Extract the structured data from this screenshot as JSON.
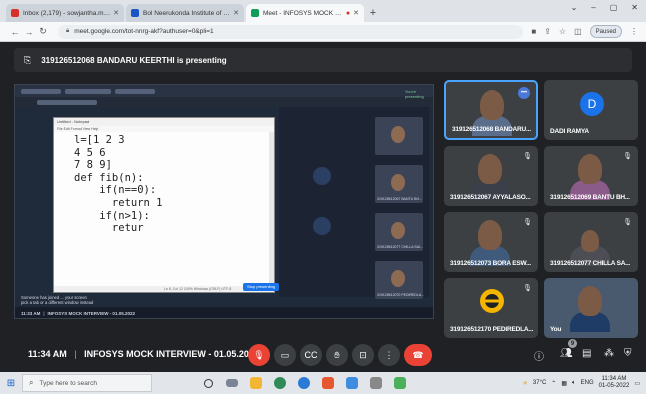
{
  "browser": {
    "tabs": [
      {
        "label": "Inbox (2,179) - sowjantha.mcr@",
        "icon_color": "#d93025",
        "active": false
      },
      {
        "label": "Bol Neerukonda Institute of Tec",
        "icon_color": "#1a56c7",
        "active": false
      },
      {
        "label": "Meet - INFOSYS MOCK INTE",
        "icon_color": "#0f9d58",
        "active": true
      }
    ],
    "new_tab_icon": "plus-icon",
    "url": "meet.google.com/tot-nnrg-akf?authuser=0&pli=1",
    "profile_label": "Paused"
  },
  "meet": {
    "presenting_text": "319126512068 BANDARU KEERTHI is presenting",
    "shared_screen": {
      "notepad_title": "Untitled - Notepad",
      "notepad_menu": "File  Edit  Format  View  Help",
      "code_lines": [
        "l=[1 2 3",
        "4 5 6",
        "7 8 9]",
        "def fib(n):",
        "    if(n==0):",
        "      return 1",
        "    if(n>1):",
        "      retur"
      ],
      "presenting_label": "You're presenting",
      "tile_labels": [
        "319126512067 BANTU BH...",
        "319126512077 CHILLA SAI...",
        "319126512070 PEDIREDLA..."
      ],
      "notice_line1": "Someone has joined ... your screen",
      "notice_line2": "pick a tab or a different window instead",
      "stop_label": "Stop presenting",
      "footer_time": "11:33 AM",
      "footer_title": "INFOSYS MOCK INTERVIEW - 01.05.2022"
    },
    "participants": [
      {
        "name": "319126512068 BANDARU...",
        "type": "person",
        "highlight": true
      },
      {
        "name": "DADI RAMYA",
        "type": "avatar",
        "initial": "D",
        "avatar_color": "#1a73e8"
      },
      {
        "name": "319126512067 AYYALASO...",
        "type": "person"
      },
      {
        "name": "319126512069 BANTU BH...",
        "type": "person"
      },
      {
        "name": "319126512073 BORA ESW...",
        "type": "person"
      },
      {
        "name": "319126512077 CHILLA SA...",
        "type": "person"
      },
      {
        "name": "319126512170 PEDIREDLA...",
        "type": "logo"
      },
      {
        "name": "You",
        "type": "person"
      }
    ],
    "controls": {
      "time": "11:34 AM",
      "meeting_title": "INFOSYS MOCK INTERVIEW - 01.05.2022",
      "separator": "|",
      "people_badge": "9",
      "buttons": [
        "mic-off",
        "camera",
        "captions",
        "raise-hand",
        "present",
        "more",
        "leave-call"
      ]
    }
  },
  "taskbar": {
    "search_placeholder": "Type here to search",
    "weather": "37°C",
    "language": "ENG",
    "time": "11:34 AM",
    "date": "01-05-2022"
  }
}
